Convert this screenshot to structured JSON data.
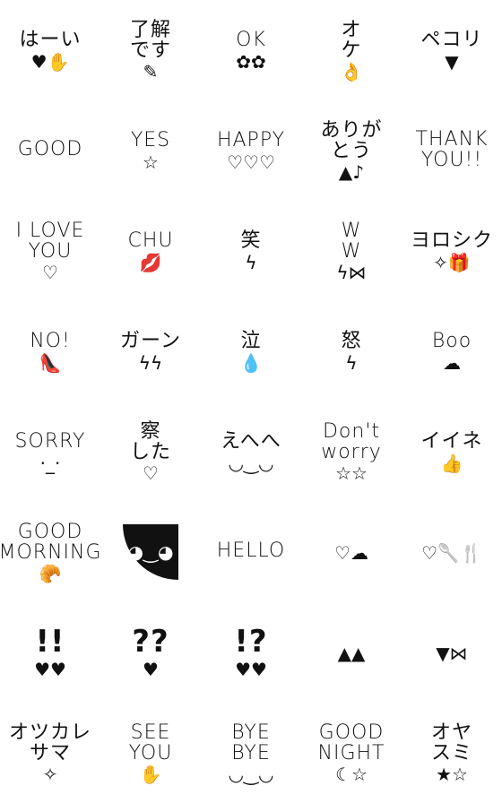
{
  "stickers": [
    {
      "text": "はーい",
      "glyph": "♥✋"
    },
    {
      "text": "了解\nです",
      "glyph": "✎"
    },
    {
      "text": "OK",
      "glyph": "✿✿"
    },
    {
      "text": "オ\nケ",
      "glyph": "👌"
    },
    {
      "text": "ペコリ",
      "glyph": "▼"
    },
    {
      "text": "GOOD",
      "glyph": ""
    },
    {
      "text": "YES",
      "glyph": "☆"
    },
    {
      "text": "HAPPY",
      "glyph": "♡♡♡"
    },
    {
      "text": "ありが\nとう",
      "glyph": "▲♪"
    },
    {
      "text": "THANK\nYOU!!",
      "glyph": ""
    },
    {
      "text": "I LOVE\nYOU",
      "glyph": "♡"
    },
    {
      "text": "CHU",
      "glyph": "💋"
    },
    {
      "text": "笑",
      "glyph": "ϟ"
    },
    {
      "text": "W\nW",
      "glyph": "ϟ⋈"
    },
    {
      "text": "ヨロシク",
      "glyph": "✧🎁"
    },
    {
      "text": "NO!",
      "glyph": "👠"
    },
    {
      "text": "ガーン",
      "glyph": "ϟϟ"
    },
    {
      "text": "泣",
      "glyph": "💧"
    },
    {
      "text": "怒",
      "glyph": "ϟ"
    },
    {
      "text": "Boo",
      "glyph": "☁"
    },
    {
      "text": "SORRY",
      "glyph": "·_·"
    },
    {
      "text": "察\nした",
      "glyph": "♡"
    },
    {
      "text": "えへへ",
      "glyph": "◡‿◡"
    },
    {
      "text": "Don't\nworry",
      "glyph": "☆☆"
    },
    {
      "text": "イイネ",
      "glyph": "👍"
    },
    {
      "text": "GOOD\nMORNING",
      "glyph": "🥐"
    },
    {
      "text": "",
      "glyph": "◕‿◕"
    },
    {
      "text": "HELLO",
      "glyph": ""
    },
    {
      "text": "",
      "glyph": "♡☁"
    },
    {
      "text": "",
      "glyph": "♡🥄🍴"
    },
    {
      "text": "!!",
      "glyph": "♥♥"
    },
    {
      "text": "??",
      "glyph": "♥"
    },
    {
      "text": "!?",
      "glyph": "♥♥"
    },
    {
      "text": "",
      "glyph": "▲▲"
    },
    {
      "text": "",
      "glyph": "▼⋈"
    },
    {
      "text": "オツカレ\nサマ",
      "glyph": "✧"
    },
    {
      "text": "SEE\nYOU",
      "glyph": "✋"
    },
    {
      "text": "BYE\nBYE",
      "glyph": "◡‿◡"
    },
    {
      "text": "GOOD\nNIGHT",
      "glyph": "☾☆"
    },
    {
      "text": "オヤ\nスミ",
      "glyph": "★☆"
    }
  ]
}
